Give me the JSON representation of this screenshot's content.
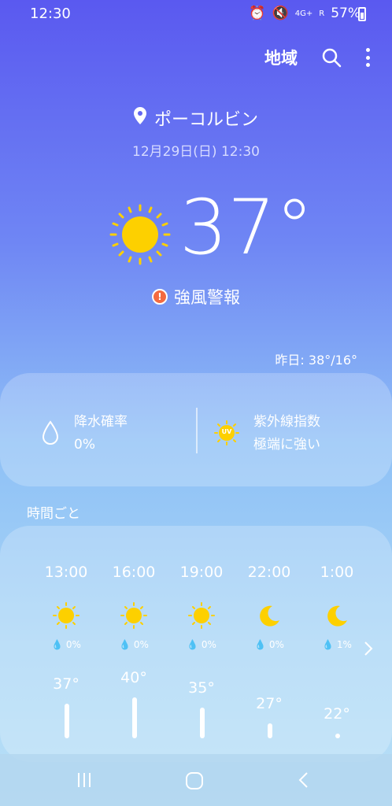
{
  "status_bar": {
    "time": "12:30",
    "network": "4G+",
    "roaming": "R",
    "battery": "57%"
  },
  "header": {
    "region_label": "地域"
  },
  "location": {
    "name": "ポーコルビン",
    "datetime": "12月29日(日) 12:30"
  },
  "current": {
    "temperature": "37°",
    "condition_icon": "sun-icon"
  },
  "warning": {
    "badge": "!",
    "text": "強風警報"
  },
  "yesterday": {
    "text": "昨日: 38°/16°"
  },
  "details": {
    "precip_label": "降水確率",
    "precip_value": "0%",
    "uv_label": "紫外線指数",
    "uv_value": "極端に強い",
    "uv_icon_text": "UV"
  },
  "hourly": {
    "title": "時間ごと",
    "items": [
      {
        "time": "13:00",
        "icon": "sun-icon",
        "precip": "0%",
        "temp": "37°",
        "temp_value": 37
      },
      {
        "time": "16:00",
        "icon": "sun-icon",
        "precip": "0%",
        "temp": "40°",
        "temp_value": 40
      },
      {
        "time": "19:00",
        "icon": "sun-icon",
        "precip": "0%",
        "temp": "35°",
        "temp_value": 35
      },
      {
        "time": "22:00",
        "icon": "moon-icon",
        "precip": "0%",
        "temp": "27°",
        "temp_value": 27
      },
      {
        "time": "1:00",
        "icon": "moon-icon",
        "precip": "1%",
        "temp": "22°",
        "temp_value": 22
      }
    ]
  },
  "colors": {
    "sun": "#fdd000",
    "warning": "#f46a40"
  }
}
